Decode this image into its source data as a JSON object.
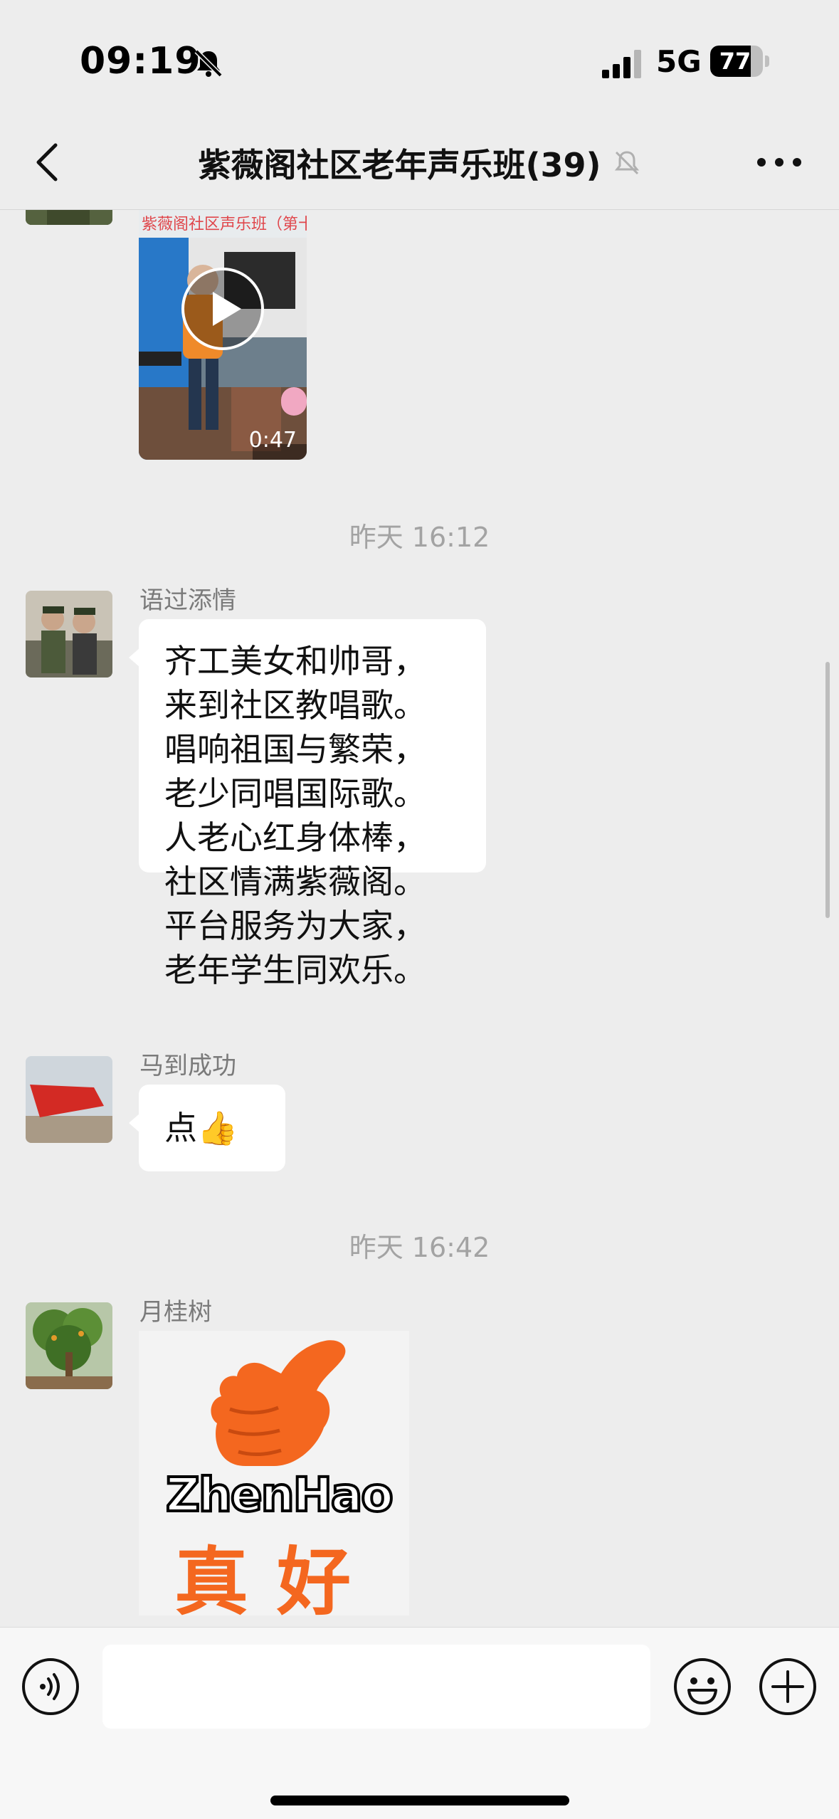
{
  "status_bar": {
    "time": "09:19",
    "network": "5G",
    "battery": "77",
    "battery_level": 0.77
  },
  "header": {
    "title": "紫薇阁社区老年声乐班(39)"
  },
  "messages": {
    "video": {
      "duration": "0:47",
      "banner_text": "紫薇阁社区声乐班（第十"
    },
    "time_1": "昨天 16:12",
    "msg_1": {
      "sender": "语过添情",
      "lines": [
        "齐工美女和帅哥，",
        "来到社区教唱歌。",
        "唱响祖国与繁荣，",
        "老少同唱国际歌。",
        "人老心红身体棒，",
        "社区情满紫薇阁。",
        "平台服务为大家，",
        "老年学生同欢乐。"
      ]
    },
    "msg_2": {
      "sender": "马到成功",
      "text": "点👍"
    },
    "time_2": "昨天 16:42",
    "msg_3": {
      "sender": "月桂树",
      "sticker_word": "ZhenHao",
      "sticker_cn": "真好"
    }
  },
  "input": {
    "placeholder": ""
  },
  "colors": {
    "background": "#ededed",
    "bubble": "#ffffff",
    "sticker_orange": "#f4671f"
  }
}
